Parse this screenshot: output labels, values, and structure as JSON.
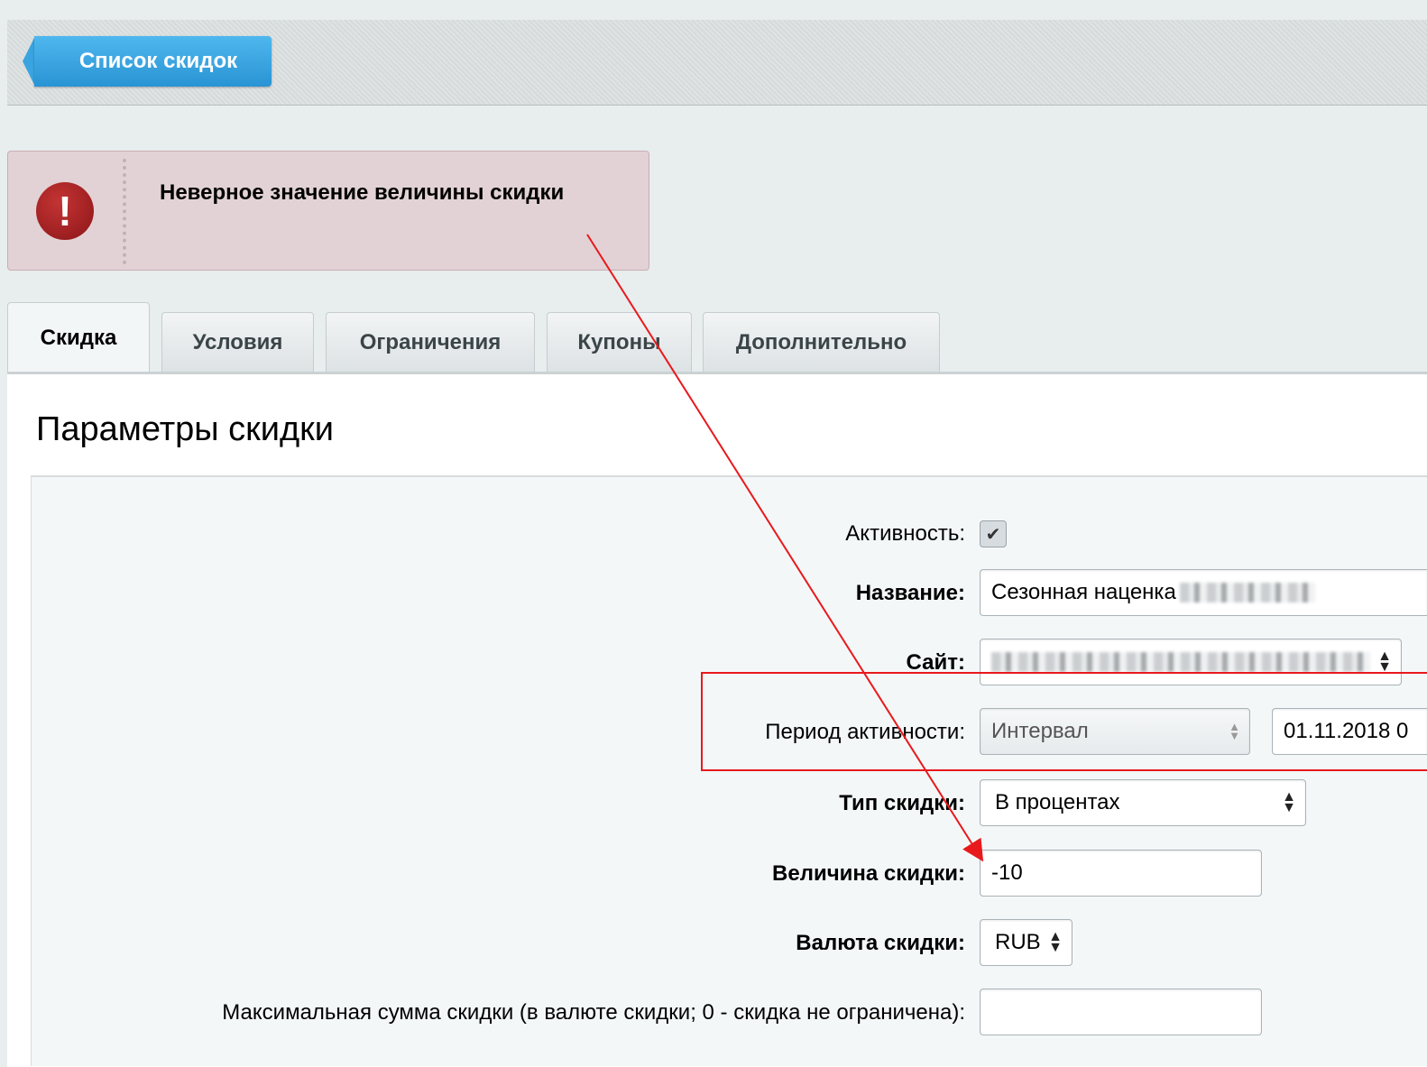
{
  "toolbar": {
    "back_button_label": "Список скидок"
  },
  "error": {
    "icon": "exclamation-icon",
    "message": "Неверное значение величины скидки"
  },
  "tabs": [
    {
      "label": "Скидка",
      "active": true
    },
    {
      "label": "Условия"
    },
    {
      "label": "Ограничения"
    },
    {
      "label": "Купоны"
    },
    {
      "label": "Дополнительно"
    }
  ],
  "panel": {
    "title": "Параметры скидки"
  },
  "form": {
    "active": {
      "label": "Активность:",
      "checked": true
    },
    "name": {
      "label": "Название:",
      "value": "Сезонная наценка"
    },
    "site": {
      "label": "Сайт:"
    },
    "period": {
      "label": "Период активности:",
      "mode": "Интервал",
      "date_from": "01.11.2018 0"
    },
    "discount_type": {
      "label": "Тип скидки:",
      "value": "В процентах"
    },
    "discount_value": {
      "label": "Величина скидки:",
      "value": "-10"
    },
    "currency": {
      "label": "Валюта скидки:",
      "value": "RUB"
    },
    "max_sum": {
      "label": "Максимальная сумма скидки (в валюте скидки; 0 - скидка не ограничена):",
      "value": ""
    }
  },
  "colors": {
    "annotation": "#e8191c",
    "accent": "#2994d4",
    "error_bg": "#e2d2d6"
  }
}
